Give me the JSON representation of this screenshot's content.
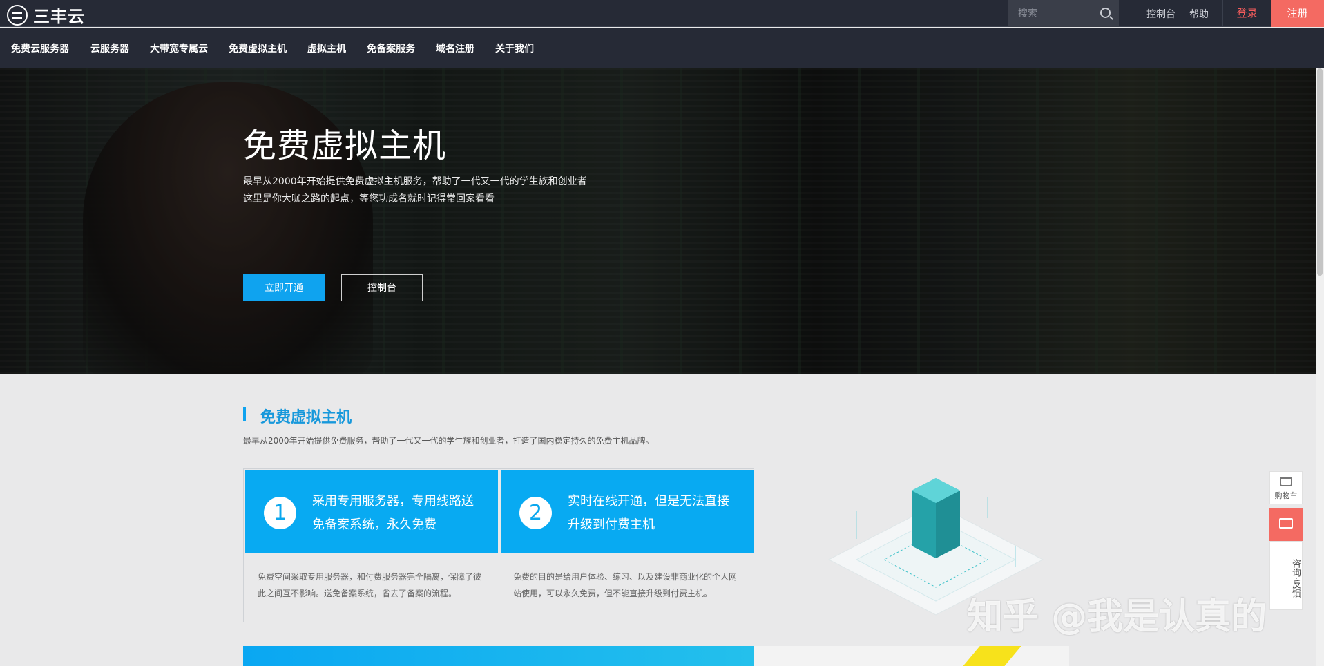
{
  "header": {
    "logo_text": "三丰云",
    "search_placeholder": "搜索",
    "links": [
      "控制台",
      "帮助"
    ],
    "login": "登录",
    "register": "注册"
  },
  "nav": {
    "items": [
      "免费云服务器",
      "云服务器",
      "大带宽专属云",
      "免费虚拟主机",
      "虚拟主机",
      "免备案服务",
      "域名注册",
      "关于我们"
    ]
  },
  "hero": {
    "title": "免费虚拟主机",
    "desc_line1": "最早从2000年开始提供免费虚拟主机服务，帮助了一代又一代的学生族和创业者",
    "desc_line2": "这里是你大咖之路的起点，等您功成名就时记得常回家看看",
    "primary_button": "立即开通",
    "secondary_button": "控制台"
  },
  "section": {
    "title": "免费虚拟主机",
    "desc": "最早从2000年开始提供免费服务，帮助了一代又一代的学生族和创业者，打造了国内稳定持久的免费主机品牌。",
    "cards": [
      {
        "num": "1",
        "title": "采用专用服务器，专用线路送免备案系统，永久免费",
        "body": "免费空间采取专用服务器，和付费服务器完全隔离，保障了彼此之间互不影响。送免备案系统，省去了备案的流程。"
      },
      {
        "num": "2",
        "title": "实时在线开通，但是无法直接升级到付费主机",
        "body": "免费的目的是给用户体验、练习、以及建设非商业化的个人网站使用，可以永久免费，但不能直接升级到付费主机。"
      }
    ]
  },
  "float": {
    "cart": "购物车",
    "feedback": "咨询·反馈"
  },
  "watermark": "知乎 @我是认真的"
}
